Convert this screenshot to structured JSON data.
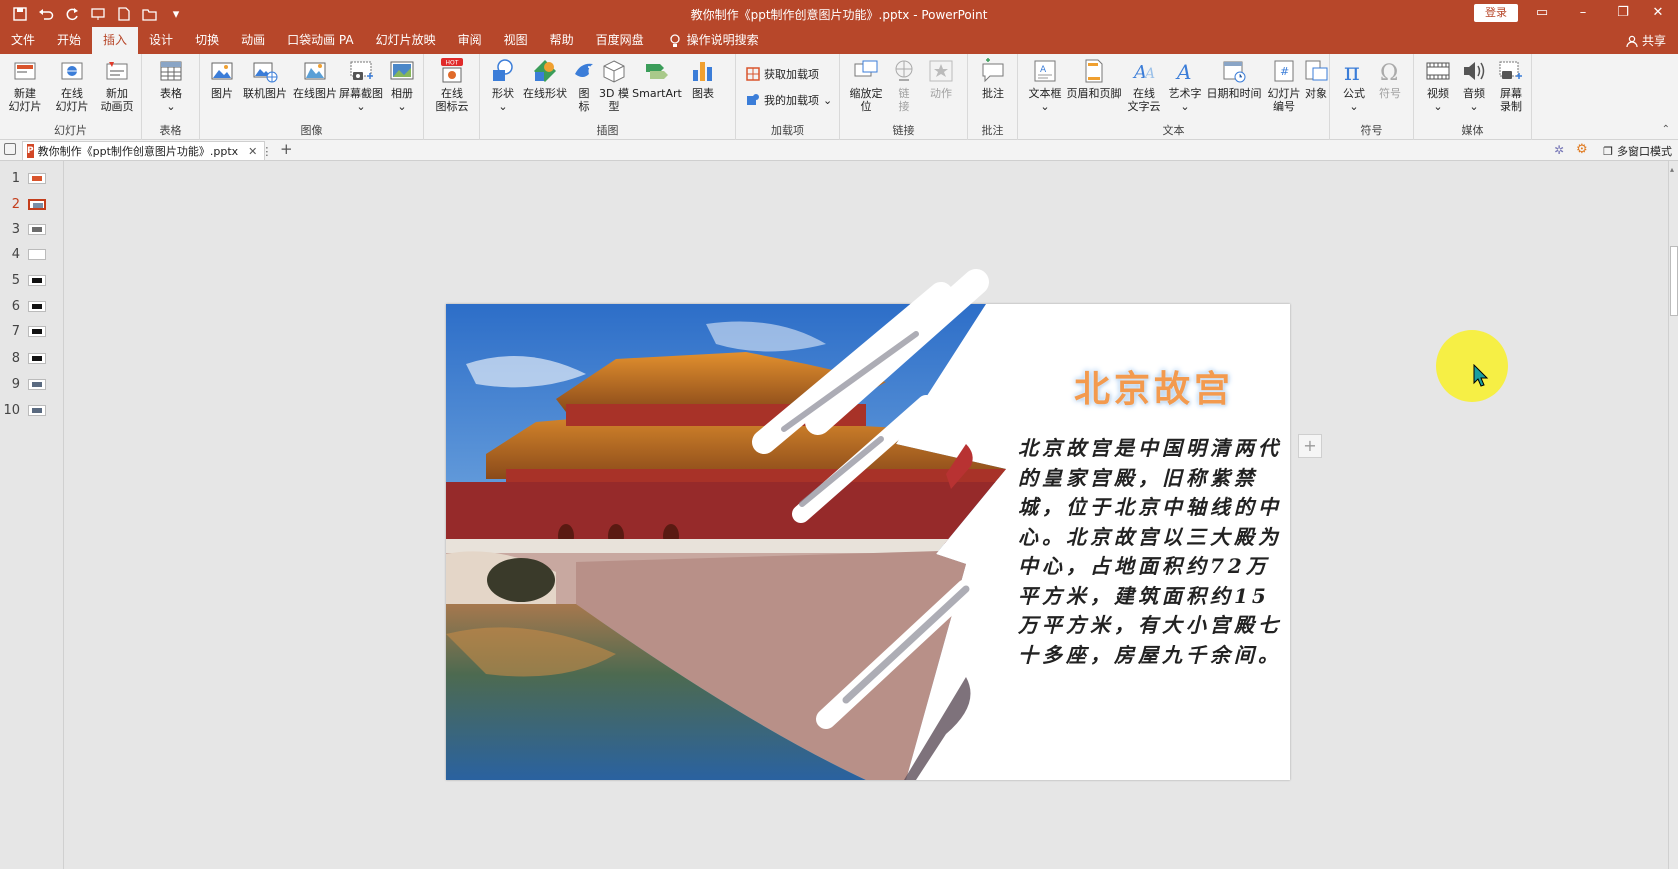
{
  "app": {
    "title": "教你制作《ppt制作创意图片功能》.pptx  -  PowerPoint",
    "login": "登录",
    "share": "共享",
    "tell_me": "操作说明搜索"
  },
  "menu_tabs": [
    "文件",
    "开始",
    "插入",
    "设计",
    "切换",
    "动画",
    "口袋动画 PA",
    "幻灯片放映",
    "审阅",
    "视图",
    "帮助",
    "百度网盘"
  ],
  "active_tab": "插入",
  "ribbon": {
    "groups": {
      "slides": "幻灯片",
      "tables": "表格",
      "images": "图像",
      "illustrations": "插图",
      "addins": "加载项",
      "links": "链接",
      "comments": "批注",
      "text": "文本",
      "symbols": "符号",
      "media": "媒体"
    },
    "buttons": {
      "new_slide_1": "新建",
      "new_slide_2": "幻灯片",
      "online_slide_1": "在线",
      "online_slide_2": "幻灯片",
      "new_anim_1": "新加",
      "new_anim_2": "动画页",
      "table": "表格",
      "picture": "图片",
      "online_picture": "联机图片",
      "online_image": "在线图片",
      "screenshot": "屏幕截图",
      "album": "相册",
      "icon_cloud_1": "在线",
      "icon_cloud_2": "图标云",
      "hot": "HOT",
      "shapes": "形状",
      "online_shapes": "在线形状",
      "icons_1": "图",
      "icons_2": "标",
      "model3d_1": "3D 模",
      "model3d_2": "型",
      "smartart": "SmartArt",
      "chart": "图表",
      "get_addins": "获取加载项",
      "my_addins": "我的加载项",
      "zoom_1": "缩放定",
      "zoom_2": "位",
      "link_1": "链",
      "link_2": "接",
      "action": "动作",
      "comment": "批注",
      "textbox": "文本框",
      "header_footer": "页眉和页脚",
      "online_text_1": "在线",
      "online_text_2": "文字云",
      "wordart": "艺术字",
      "datetime": "日期和时间",
      "slide_num_1": "幻灯片",
      "slide_num_2": "编号",
      "object": "对象",
      "equation": "公式",
      "symbol": "符号",
      "video": "视频",
      "audio": "音频",
      "screen_rec_1": "屏幕",
      "screen_rec_2": "录制"
    }
  },
  "doc_tab": {
    "name": "教你制作《ppt制作创意图片功能》.pptx",
    "multi_window": "多窗口模式"
  },
  "thumbnails": [
    {
      "num": "1",
      "color": "#d9542c"
    },
    {
      "num": "2",
      "color": "#7a8fa8"
    },
    {
      "num": "3",
      "color": "#6c6c6c"
    },
    {
      "num": "4",
      "color": "#ffffff"
    },
    {
      "num": "5",
      "color": "#111111"
    },
    {
      "num": "6",
      "color": "#111111"
    },
    {
      "num": "7",
      "color": "#111111"
    },
    {
      "num": "8",
      "color": "#111111"
    },
    {
      "num": "9",
      "color": "#5a6a80"
    },
    {
      "num": "10",
      "color": "#5a6a80"
    }
  ],
  "selected_slide": "2",
  "slide": {
    "title": "北京故宫",
    "body": "北京故宫是中国明清两代的皇家宫殿，旧称紫禁城，位于北京中轴线的中心。北京故宫以三大殿为中心，占地面积约72万平方米，建筑面积约15万平方米，有大小宫殿七十多座，房屋九千余间。"
  },
  "colors": {
    "accent": "#b7472a",
    "title_orange": "#f39a4e"
  }
}
